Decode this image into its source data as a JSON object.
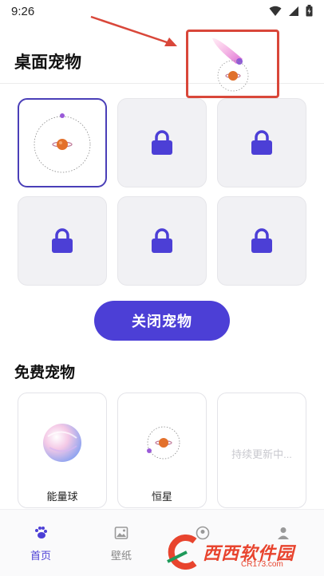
{
  "status": {
    "time": "9:26"
  },
  "header": {
    "title": "桌面宠物"
  },
  "pets": {
    "slots": [
      {
        "state": "selected",
        "pet": "star-orbit"
      },
      {
        "state": "locked"
      },
      {
        "state": "locked"
      },
      {
        "state": "locked"
      },
      {
        "state": "locked"
      },
      {
        "state": "locked"
      }
    ]
  },
  "actions": {
    "close_pet_label": "关闭宠物"
  },
  "free_pets": {
    "title": "免费宠物",
    "items": [
      {
        "name": "能量球",
        "icon": "energy-ball"
      },
      {
        "name": "恒星",
        "icon": "star-orbit"
      },
      {
        "placeholder": "持续更新中..."
      }
    ]
  },
  "nav": {
    "items": [
      {
        "label": "首页",
        "icon": "paw-icon",
        "active": true
      },
      {
        "label": "壁纸",
        "icon": "image-icon",
        "active": false
      },
      {
        "label": "",
        "icon": "profile-icon",
        "active": false
      },
      {
        "label": "",
        "icon": "user-icon",
        "active": false
      }
    ]
  },
  "watermark": {
    "brand": "西西软件园",
    "domain": "CR173.com"
  },
  "colors": {
    "accent": "#4c3fd6",
    "lock": "#4c3fd6",
    "annotation": "#d9473a"
  }
}
